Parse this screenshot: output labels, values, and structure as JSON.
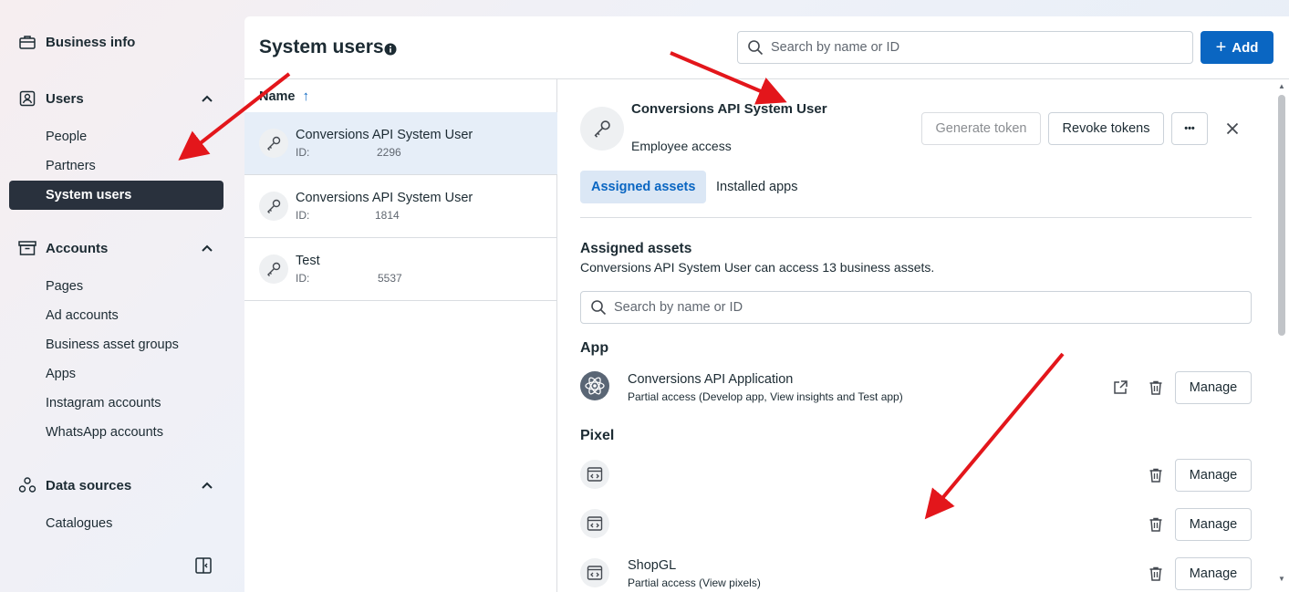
{
  "sidebar": {
    "business_info": "Business info",
    "users": {
      "label": "Users",
      "items": [
        "People",
        "Partners",
        "System users"
      ]
    },
    "accounts": {
      "label": "Accounts",
      "items": [
        "Pages",
        "Ad accounts",
        "Business asset groups",
        "Apps",
        "Instagram accounts",
        "WhatsApp accounts"
      ]
    },
    "data_sources": {
      "label": "Data sources",
      "items": [
        "Catalogues"
      ]
    }
  },
  "header": {
    "title": "System users",
    "search_placeholder": "Search by name or ID",
    "add_label": "Add"
  },
  "list": {
    "column": "Name",
    "users": [
      {
        "name": "Conversions API System User",
        "id_label": "ID:",
        "id_suffix": "2296"
      },
      {
        "name": "Conversions API System User",
        "id_label": "ID:",
        "id_suffix": "1814"
      },
      {
        "name": "Test",
        "id_label": "ID:",
        "id_suffix": "5537"
      }
    ]
  },
  "detail": {
    "name": "Conversions API System User",
    "role": "Employee access",
    "generate_token": "Generate token",
    "revoke_tokens": "Revoke tokens",
    "more": "•••",
    "tabs": [
      "Assigned assets",
      "Installed apps"
    ],
    "assets_title": "Assigned assets",
    "assets_subtitle": "Conversions API System User can access 13 business assets.",
    "assets_search_placeholder": "Search by name or ID",
    "groups": {
      "app": {
        "title": "App",
        "items": [
          {
            "name": "Conversions API Application",
            "access": "Partial access (Develop app, View insights and Test app)",
            "manage": "Manage"
          }
        ]
      },
      "pixel": {
        "title": "Pixel",
        "items": [
          {
            "name": "",
            "access": "",
            "manage": "Manage"
          },
          {
            "name": "",
            "access": "",
            "manage": "Manage"
          },
          {
            "name": "ShopGL",
            "access": "Partial access (View pixels)",
            "manage": "Manage"
          }
        ]
      }
    }
  },
  "colors": {
    "accent": "#0a66c2",
    "active_nav": "#29313d",
    "annotation_arrow": "#e3161b"
  }
}
